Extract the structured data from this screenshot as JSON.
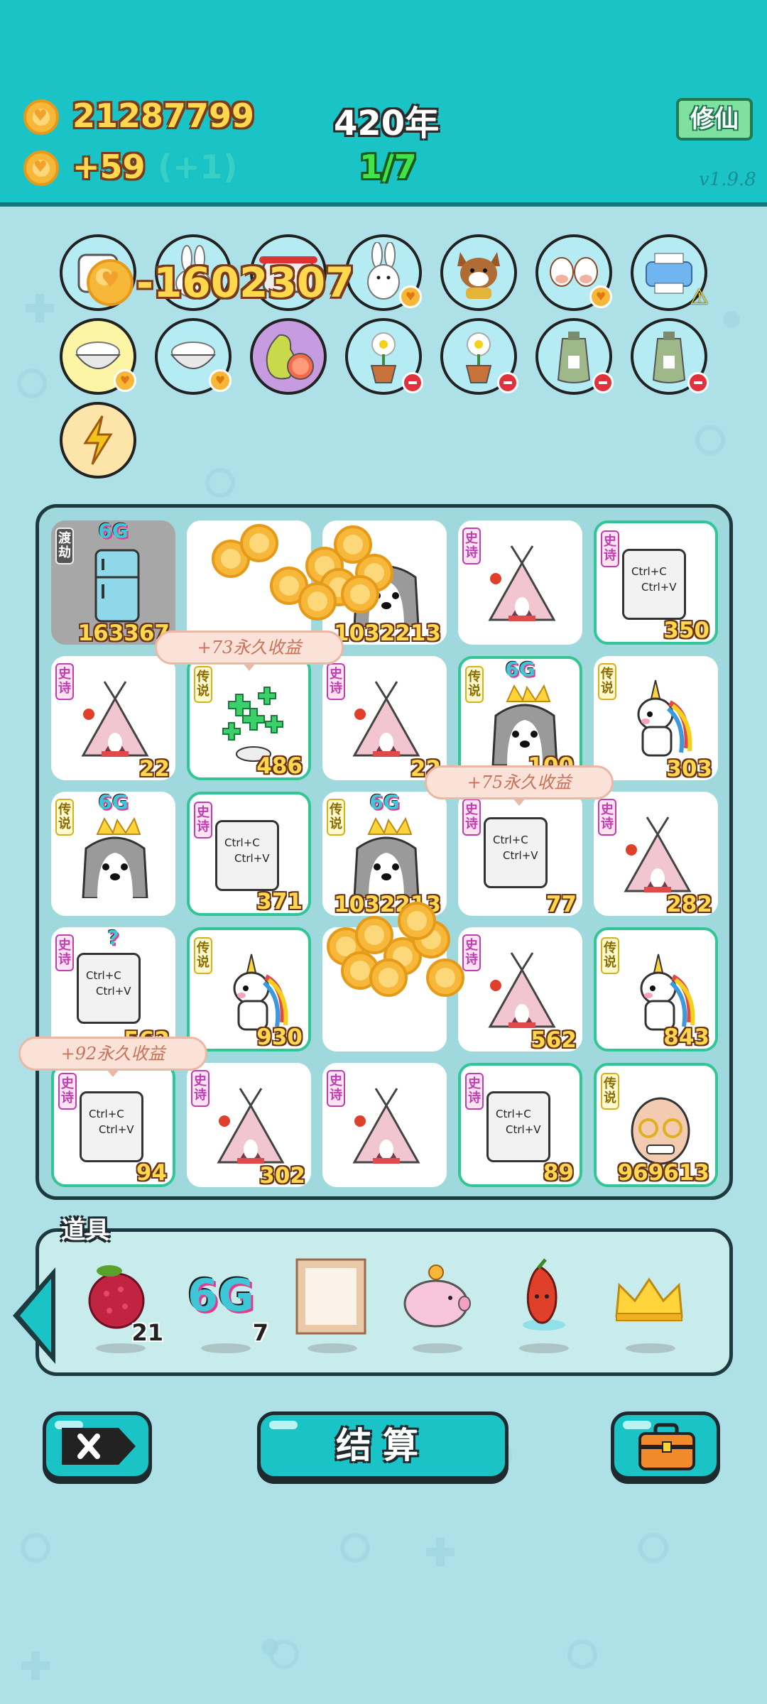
{
  "header": {
    "coins": "21287799",
    "income": "+59",
    "bonus": "(+1)",
    "year": "420年",
    "progress": "1/7",
    "mode_button": "修仙",
    "version": "v1.9.8"
  },
  "floating_delta": "-1602307",
  "circle_row1": [
    "plate-icon",
    "rabbit-icon",
    "rice-cooker-icon",
    "rabbit-icon",
    "dog-icon",
    "cows-icon",
    "printer-icon"
  ],
  "circle_row2": [
    "rice-bowl-icon",
    "rice-bowl-icon",
    "grapefruit-icon",
    "flower-pot-icon",
    "flower-pot-icon",
    "sack-icon",
    "sack-icon"
  ],
  "circle_row3": [
    "lightning-icon"
  ],
  "board": {
    "cells": [
      {
        "tag": "渡劫",
        "art": "fridge",
        "top": "6G",
        "value": "163367",
        "gray": true
      },
      {
        "tag": "",
        "art": "coins",
        "value": ""
      },
      {
        "tag": "",
        "art": "husky",
        "value": "1032213"
      },
      {
        "tag": "史诗",
        "art": "tent",
        "value": ""
      },
      {
        "tag": "史诗",
        "art": "ctrl",
        "value": "350",
        "green": true
      },
      {
        "tag": "史诗",
        "art": "tent",
        "value": "22"
      },
      {
        "tag": "传说",
        "art": "clover",
        "value": "486",
        "green": true
      },
      {
        "tag": "史诗",
        "art": "tent",
        "value": "22"
      },
      {
        "tag": "传说",
        "art": "husky",
        "top": "6G",
        "value": "100",
        "green": true
      },
      {
        "tag": "传说",
        "art": "unicorn",
        "value": "303"
      },
      {
        "tag": "传说",
        "art": "husky",
        "top": "6G",
        "value": ""
      },
      {
        "tag": "史诗",
        "art": "ctrl",
        "value": "371",
        "green": true
      },
      {
        "tag": "传说",
        "art": "husky",
        "top": "6G",
        "value": "1032213"
      },
      {
        "tag": "史诗",
        "art": "ctrl",
        "value": "77"
      },
      {
        "tag": "史诗",
        "art": "tent",
        "value": "282"
      },
      {
        "tag": "史诗",
        "art": "ctrl",
        "top": "?",
        "value": "562"
      },
      {
        "tag": "传说",
        "art": "unicorn",
        "value": "930",
        "green": true
      },
      {
        "tag": "",
        "art": "coins",
        "value": ""
      },
      {
        "tag": "史诗",
        "art": "tent",
        "value": "562"
      },
      {
        "tag": "传说",
        "art": "unicorn",
        "value": "843",
        "green": true
      },
      {
        "tag": "史诗",
        "art": "ctrl",
        "value": "94",
        "green": true
      },
      {
        "tag": "史诗",
        "art": "tent",
        "value": "302"
      },
      {
        "tag": "史诗",
        "art": "tent",
        "value": ""
      },
      {
        "tag": "史诗",
        "art": "ctrl",
        "value": "89",
        "green": true
      },
      {
        "tag": "传说",
        "art": "oldman",
        "value": "969613",
        "green": true
      }
    ],
    "bubbles": [
      "+73永久收益",
      "+75永久收益",
      "+92永久收益"
    ],
    "ctrl_text": [
      "Ctrl+C",
      "Ctrl+V"
    ]
  },
  "tools": {
    "label": "道具",
    "items": [
      {
        "icon": "lychee-icon",
        "count": "21"
      },
      {
        "icon": "6g-icon",
        "text": "6G",
        "count": "7"
      },
      {
        "icon": "frame-icon",
        "count": ""
      },
      {
        "icon": "piggy-bank-icon",
        "count": ""
      },
      {
        "icon": "chili-icon",
        "count": ""
      },
      {
        "icon": "crown-icon",
        "count": ""
      }
    ]
  },
  "buttons": {
    "settle": "结算"
  },
  "colors": {
    "header_bg": "#19c3c6",
    "page_bg": "#aee0e8",
    "gold_text": "#ffd84d",
    "green_border": "#32c596"
  }
}
